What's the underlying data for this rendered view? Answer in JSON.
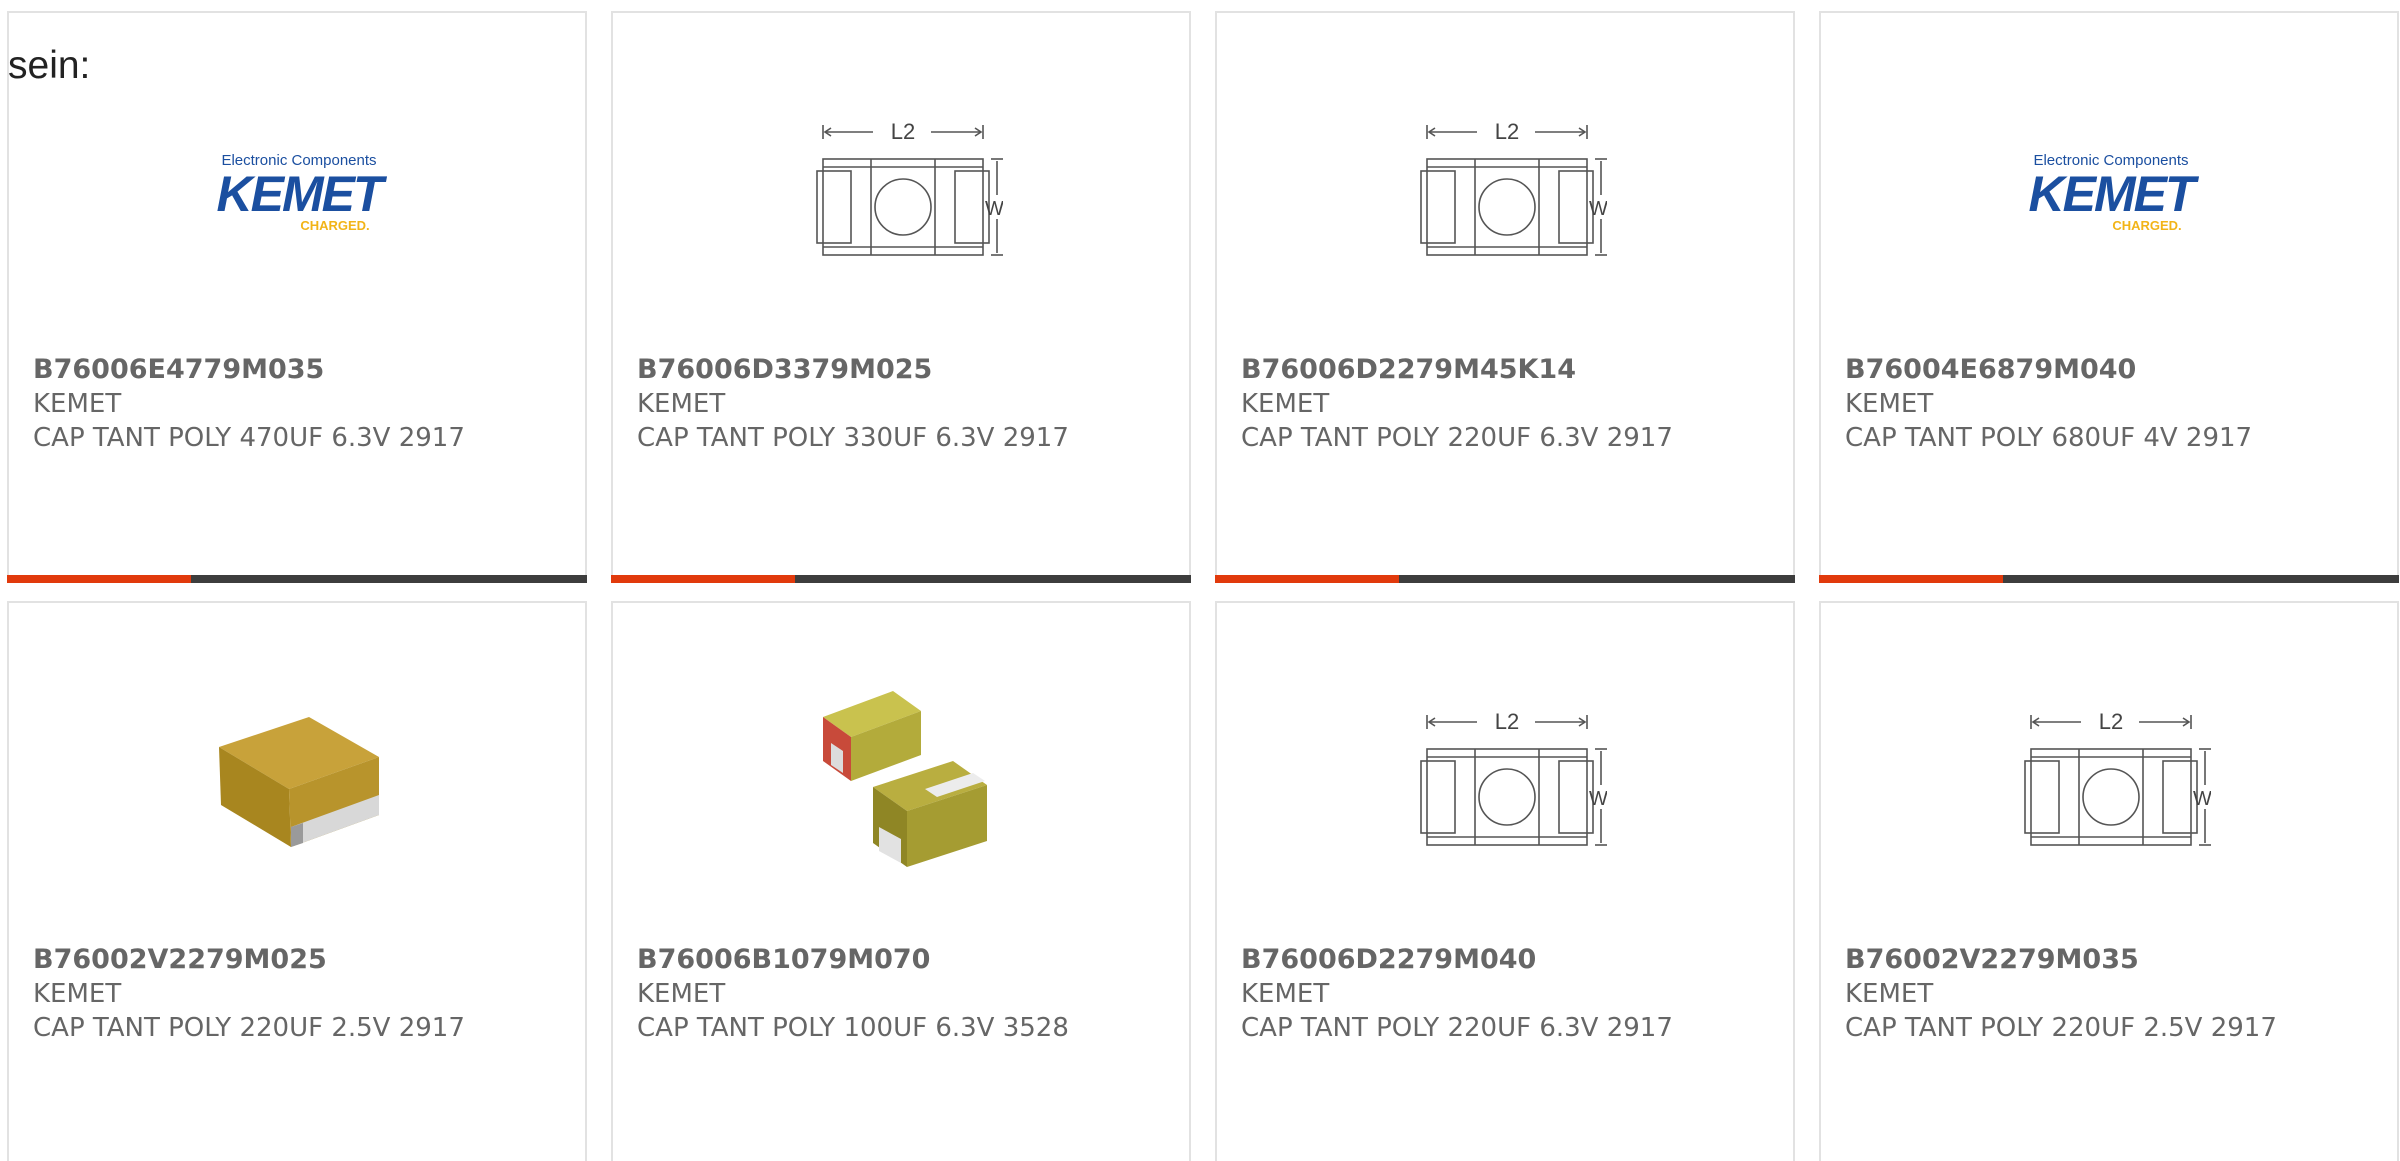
{
  "intro_text": "sein:",
  "colors": {
    "accent": "#e13a0c",
    "bar": "#3d3d3d",
    "card_border": "#e2e2e2",
    "text": "#666666",
    "kemet_blue": "#1b4fa0",
    "kemet_yellow": "#f2b418"
  },
  "logo": {
    "tagline": "Electronic Components",
    "wordmark": "KEMET",
    "sub": "CHARGED."
  },
  "drawing_labels": {
    "length": "L2",
    "width": "W"
  },
  "products": [
    {
      "part_number": "B76006E4779M035",
      "manufacturer": "KEMET",
      "description": "CAP TANT POLY 470UF 6.3V 2917",
      "image": "kemet-logo"
    },
    {
      "part_number": "B76006D3379M025",
      "manufacturer": "KEMET",
      "description": "CAP TANT POLY 330UF 6.3V 2917",
      "image": "dimension-drawing"
    },
    {
      "part_number": "B76006D2279M45K14",
      "manufacturer": "KEMET",
      "description": "CAP TANT POLY 220UF 6.3V 2917",
      "image": "dimension-drawing"
    },
    {
      "part_number": "B76004E6879M040",
      "manufacturer": "KEMET",
      "description": "CAP TANT POLY 680UF 4V 2917",
      "image": "kemet-logo"
    },
    {
      "part_number": "B76002V2279M025",
      "manufacturer": "KEMET",
      "description": "CAP TANT POLY 220UF 2.5V 2917",
      "image": "capacitor-photo"
    },
    {
      "part_number": "B76006B1079M070",
      "manufacturer": "KEMET",
      "description": "CAP TANT POLY 100UF 6.3V 3528",
      "image": "capacitor-pair-photo"
    },
    {
      "part_number": "B76006D2279M040",
      "manufacturer": "KEMET",
      "description": "CAP TANT POLY 220UF 6.3V 2917",
      "image": "dimension-drawing"
    },
    {
      "part_number": "B76002V2279M035",
      "manufacturer": "KEMET",
      "description": "CAP TANT POLY 220UF 2.5V 2917",
      "image": "dimension-drawing"
    }
  ]
}
